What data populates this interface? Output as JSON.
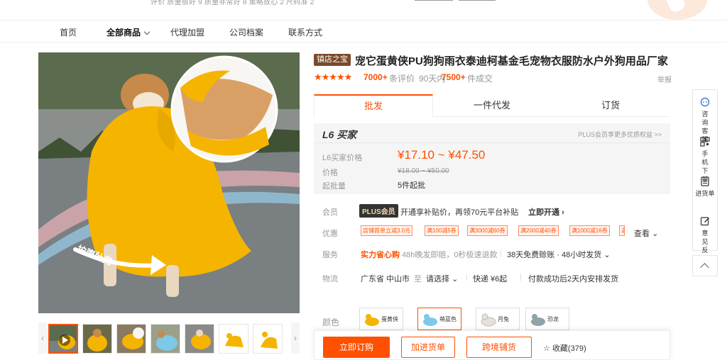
{
  "top": {
    "ratings_text": "评价   质量很好 9   质量非常好 8   策略放心 2   尺码准 2"
  },
  "nav": {
    "items": [
      "首页",
      "全部商品",
      "代理加盟",
      "公司档案",
      "联系方式"
    ]
  },
  "product": {
    "shop_badge": "镇店之宝",
    "title": "宠它蛋黄侠PU狗狗雨衣泰迪柯基金毛宠物衣服防水户外狗用品厂家",
    "stars": "★★★★★",
    "review_count": "7000+",
    "review_label": "条评价",
    "sold_prefix": "90天内",
    "sold_count": "7500+",
    "sold_label": "件成交",
    "report": "举报",
    "image_caption": "护腹肚兜"
  },
  "tabs": [
    "批发",
    "一件代发",
    "订货"
  ],
  "price": {
    "buyer_level": "L6 买家",
    "plus_hint": "PLUS会员享更多优质权益 >>",
    "buyer_price_label": "L6买家价格",
    "buyer_price": "¥17.10 ~ ¥47.50",
    "orig_label": "价格",
    "orig_price": "¥18.00 ~ ¥50.00",
    "moq_label": "起批量",
    "moq": "5件起批"
  },
  "member": {
    "label": "会员",
    "badge": "PLUS会员",
    "text": "开通享补贴价，再领70元平台补贴",
    "action": "立即开通"
  },
  "discount": {
    "label": "优惠",
    "coupons": [
      "店铺首单立减3.0元",
      "满100减5券",
      "满3000减60券",
      "满2000减40券",
      "满1000减16券"
    ],
    "more": "查看"
  },
  "service": {
    "label": "服务",
    "highlight": "实力省心购",
    "text": "48h晚发即赔，0秒极速退款",
    "free": "38天免费赊账 · 48小时发货"
  },
  "logistics": {
    "label": "物流",
    "from": "广东省 中山市",
    "to_label": "至",
    "to": "请选择",
    "shipping": "快递 ¥6起",
    "promise": "付款成功后2天内安排发货"
  },
  "colors": {
    "label": "颜色",
    "options": [
      "蛋黄侠",
      "萌蓝色",
      "月兔",
      "恐龙"
    ],
    "swatches": [
      "#f5b400",
      "#7ec8e8",
      "#e8e0d8",
      "#8fa3a8"
    ]
  },
  "actions": {
    "buy_now": "立即订购",
    "add_cart": "加进货单",
    "cross_border": "跨境铺货",
    "favorite": "收藏(379)"
  },
  "side": {
    "items": [
      "咨询客服",
      "手机下单",
      "进货单",
      "意见反馈"
    ]
  },
  "theme": {
    "accent": "#ff5000",
    "brand_badge": "#7a4a2a",
    "coat": "#f5b400"
  }
}
